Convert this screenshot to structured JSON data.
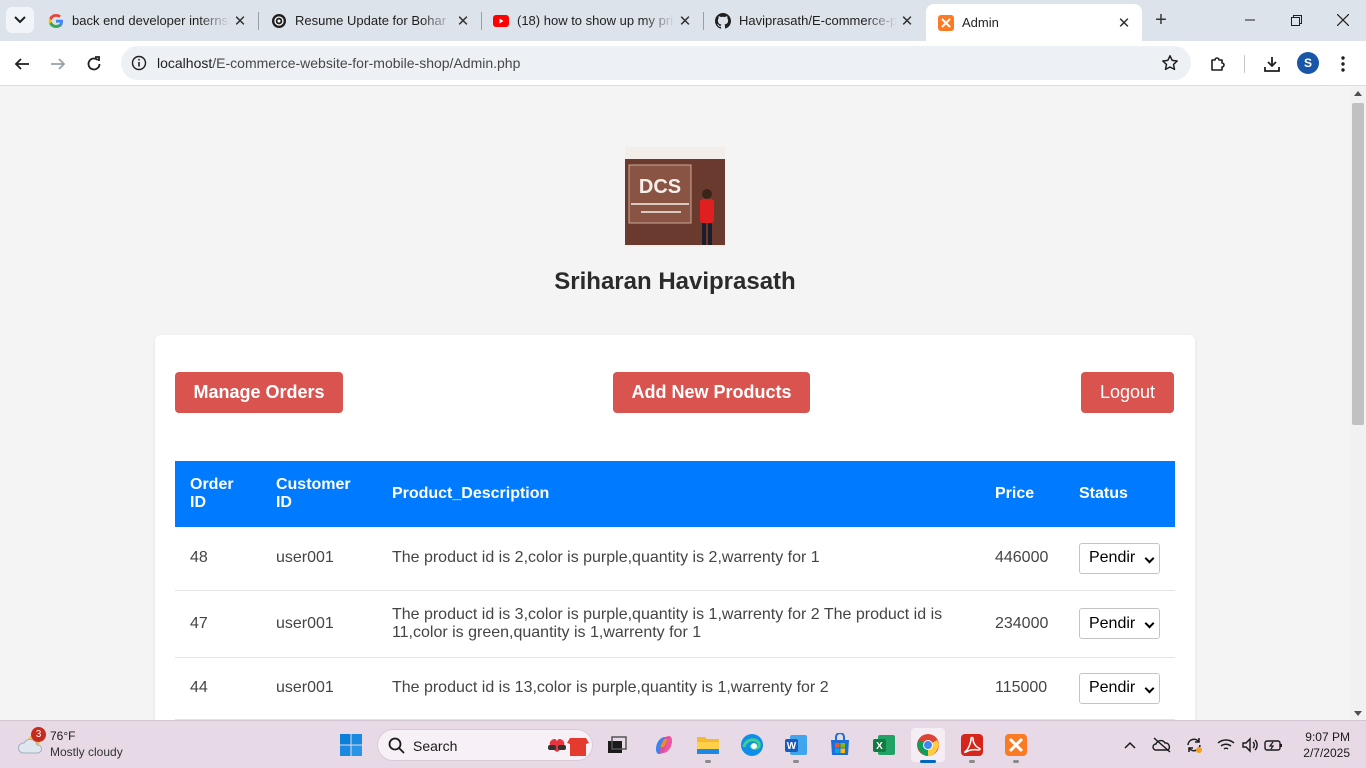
{
  "browser": {
    "tabs": [
      {
        "title": "back end developer internsh",
        "favicon": "google-icon"
      },
      {
        "title": "Resume Update for Bohar",
        "favicon": "chatgpt-icon"
      },
      {
        "title": "(18) how to show up my priv",
        "favicon": "youtube-icon"
      },
      {
        "title": "Haviprasath/E-commerce-pl",
        "favicon": "github-icon"
      },
      {
        "title": "Admin",
        "favicon": "xampp-icon",
        "active": true
      }
    ],
    "url_host": "localhost",
    "url_path": "/E-commerce-website-for-mobile-shop/Admin.php",
    "profile_initial": "S"
  },
  "page": {
    "admin_name": "Sriharan Haviprasath",
    "photo_text": "DCS",
    "buttons": {
      "manage_orders": "Manage Orders",
      "add_products": "Add New Products",
      "logout": "Logout"
    },
    "table": {
      "headers": {
        "order_id": "Order ID",
        "customer_id": "Customer ID",
        "description": "Product_Description",
        "price": "Price",
        "status": "Status"
      },
      "rows": [
        {
          "order_id": "48",
          "customer_id": "user001",
          "description": "The product id is 2,color is purple,quantity is 2,warrenty for 1",
          "price": "446000",
          "status": "Pendir"
        },
        {
          "order_id": "47",
          "customer_id": "user001",
          "description": "The product id is 3,color is purple,quantity is 1,warrenty for 2 The product id is 11,color is green,quantity is 1,warrenty for 1",
          "price": "234000",
          "status": "Pendir"
        },
        {
          "order_id": "44",
          "customer_id": "user001",
          "description": "The product id is 13,color is purple,quantity is 1,warrenty for 2",
          "price": "115000",
          "status": "Pendir"
        }
      ]
    },
    "colors": {
      "accent_red": "#d9534f",
      "table_header_blue": "#007bff"
    }
  },
  "taskbar": {
    "weather_temp": "76°F",
    "weather_desc": "Mostly cloudy",
    "weather_badge": "3",
    "search_label": "Search",
    "time": "9:07 PM",
    "date": "2/7/2025"
  }
}
